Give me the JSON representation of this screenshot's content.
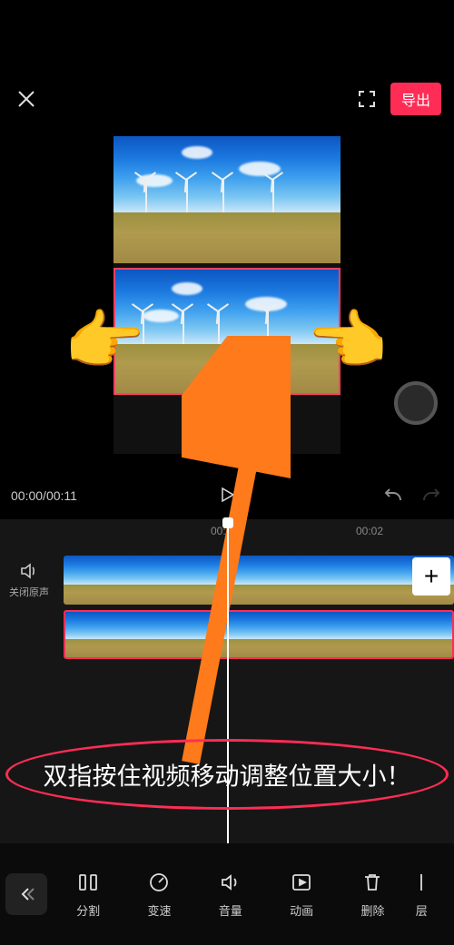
{
  "header": {
    "export_label": "导出"
  },
  "time": {
    "current": "00:00",
    "total": "00:11"
  },
  "ruler": {
    "t0": "00:00",
    "t1": "00:02"
  },
  "mute": {
    "label": "关闭原声"
  },
  "instruction": "双指按住视频移动调整位置大小！",
  "tools": [
    {
      "key": "split",
      "label": "分割"
    },
    {
      "key": "speed",
      "label": "变速"
    },
    {
      "key": "volume",
      "label": "音量"
    },
    {
      "key": "anim",
      "label": "动画"
    },
    {
      "key": "delete",
      "label": "删除"
    },
    {
      "key": "layer",
      "label": "层"
    }
  ],
  "chart_data": null
}
